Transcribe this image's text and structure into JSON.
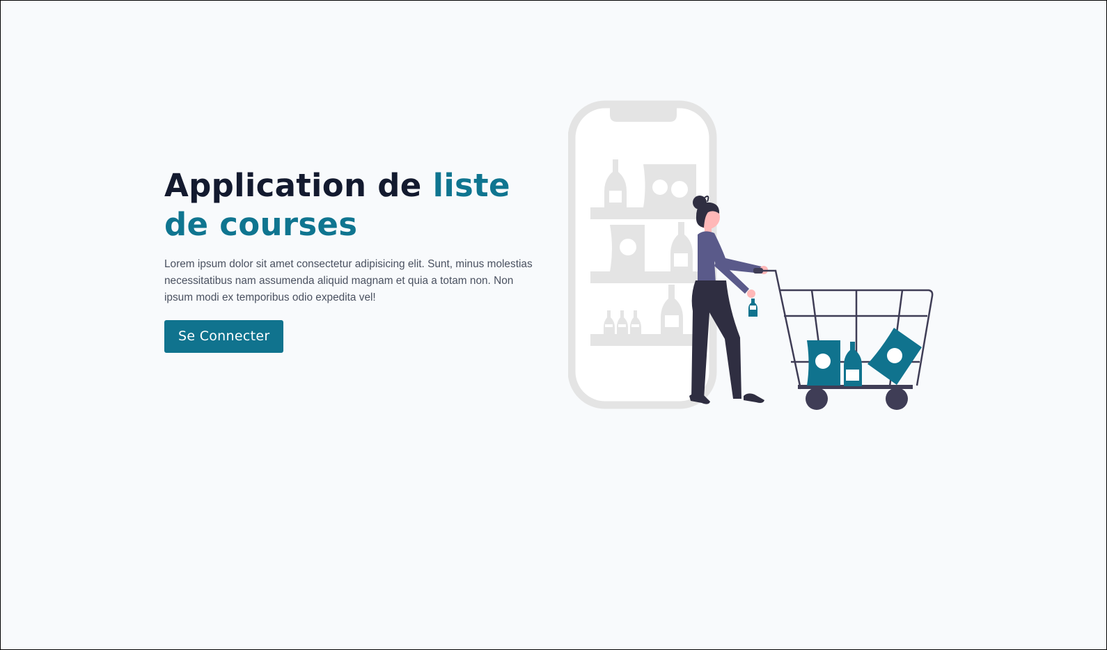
{
  "hero": {
    "title_part1": "Application de ",
    "title_part2": "liste de courses",
    "description": "Lorem ipsum dolor sit amet consectetur adipisicing elit. Sunt, minus molestias necessitatibus nam assumenda aliquid magnam et quia a totam non. Non ipsum modi ex temporibus odio expedita vel!",
    "cta_label": "Se Connecter"
  },
  "illustration": {
    "name": "woman-shopping-cart-illustration",
    "icon_names": [
      "phone-icon",
      "shelf-icon",
      "bottle-icon",
      "bag-icon",
      "woman-figure-icon",
      "shopping-cart-icon"
    ]
  },
  "colors": {
    "accent": "#10738e",
    "heading": "#131a2f",
    "body_text": "#4a5160",
    "background": "#f8fafc",
    "illustration_gray": "#e4e4e4",
    "cart_dark": "#3f3d56"
  }
}
